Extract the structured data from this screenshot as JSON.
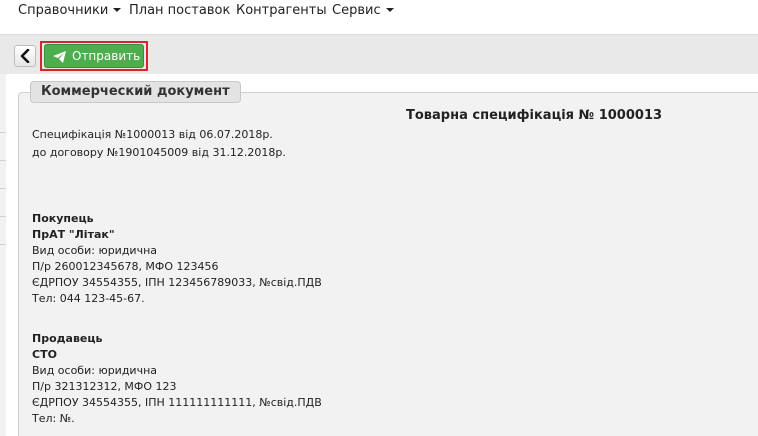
{
  "menu": {
    "items": [
      {
        "label": "Справочники",
        "dropdown": true
      },
      {
        "label": "План поставок",
        "dropdown": false
      },
      {
        "label": "Контрагенты",
        "dropdown": false
      },
      {
        "label": "Сервис",
        "dropdown": true
      }
    ]
  },
  "toolbar": {
    "back_icon": "chevron-left-icon",
    "send_icon": "paper-plane-icon",
    "send_label": "Отправить",
    "send_color": "#4cae4c",
    "highlight_color": "#d9262c"
  },
  "panel": {
    "legend": "Коммерческий документ",
    "title": "Товарна специфікація № 1000013",
    "spec_line": "Специфікація №1000013 від 06.07.2018р.",
    "contract_line": "до договору №1901045009 від 31.12.2018р.",
    "buyer": {
      "heading": "Покупець",
      "name": "ПрАТ \"Літак\"",
      "person_type": "Вид особи: юридична",
      "account": "П/р 260012345678, МФО 123456",
      "codes": "ЄДРПОУ 34554355, ІПН 123456789033, №свід.ПДВ",
      "phone": "Тел: 044 123-45-67."
    },
    "seller": {
      "heading": "Продавець",
      "name": "СТО",
      "person_type": "Вид особи: юридична",
      "account": "П/р 321312312, МФО 123",
      "codes": "ЄДРПОУ 34554355, ІПН 111111111111, №свід.ПДВ",
      "phone": "Тел: №."
    }
  }
}
